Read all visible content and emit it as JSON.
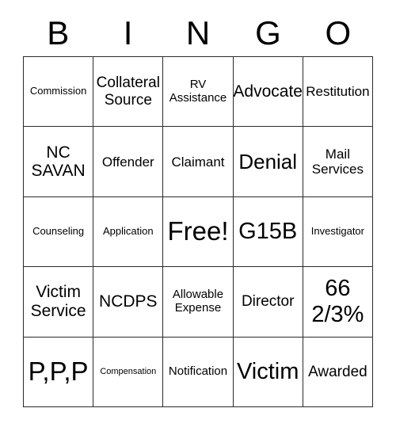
{
  "card": {
    "title": "BINGO",
    "header_letters": [
      "B",
      "I",
      "N",
      "G",
      "O"
    ],
    "columns": 5,
    "rows": 5,
    "free_space_label": "Free!",
    "colors": {
      "background": "#ffffff",
      "border": "#2b2b2b",
      "text": "#000000"
    },
    "cells": [
      {
        "text": "Commission",
        "size": "fs-s"
      },
      {
        "text": "Collateral\nSource",
        "size": "fs-ml"
      },
      {
        "text": "RV\nAssistance",
        "size": "fs-sm"
      },
      {
        "text": "Advocate",
        "size": "fs-l"
      },
      {
        "text": "Restitution",
        "size": "fs-m"
      },
      {
        "text": "NC\nSAVAN",
        "size": "fs-l"
      },
      {
        "text": "Offender",
        "size": "fs-m"
      },
      {
        "text": "Claimant",
        "size": "fs-m"
      },
      {
        "text": "Denial",
        "size": "fs-xl"
      },
      {
        "text": "Mail\nServices",
        "size": "fs-m"
      },
      {
        "text": "Counseling",
        "size": "fs-s"
      },
      {
        "text": "Application",
        "size": "fs-s"
      },
      {
        "text": "Free!",
        "size": "fs-3xl"
      },
      {
        "text": "G15B",
        "size": "fs-xxl"
      },
      {
        "text": "Investigator",
        "size": "fs-s"
      },
      {
        "text": "Victim\nService",
        "size": "fs-l"
      },
      {
        "text": "NCDPS",
        "size": "fs-l"
      },
      {
        "text": "Allowable\nExpense",
        "size": "fs-sm"
      },
      {
        "text": "Director",
        "size": "fs-ml"
      },
      {
        "text": "66\n2/3%",
        "size": "fs-xxl"
      },
      {
        "text": "P,P,P",
        "size": "fs-3xl"
      },
      {
        "text": "Compensation",
        "size": "fs-xs"
      },
      {
        "text": "Notification",
        "size": "fs-sm"
      },
      {
        "text": "Victim",
        "size": "fs-xxl"
      },
      {
        "text": "Awarded",
        "size": "fs-ml"
      }
    ]
  }
}
